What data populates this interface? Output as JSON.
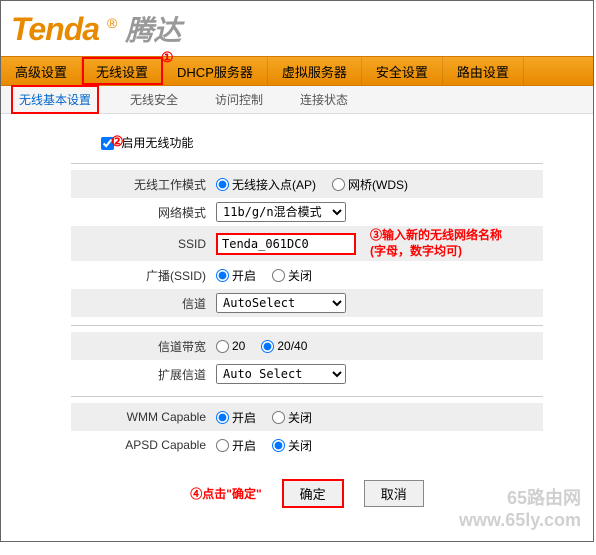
{
  "logo": {
    "text": "Tenda",
    "reg": "®",
    "cn": "腾达"
  },
  "mainNav": {
    "items": [
      "高级设置",
      "无线设置",
      "DHCP服务器",
      "虚拟服务器",
      "安全设置",
      "路由设置"
    ]
  },
  "subNav": {
    "items": [
      "无线基本设置",
      "无线安全",
      "访问控制",
      "连接状态"
    ]
  },
  "annotations": {
    "a1": "①",
    "a2": "②",
    "a3line1": "③输入新的无线网络名称",
    "a3line2": "(字母，数字均可)",
    "a4": "④点击\"确定\""
  },
  "form": {
    "enableLabel": "启用无线功能",
    "workModeLabel": "无线工作模式",
    "workModeOptA": "无线接入点(AP)",
    "workModeOptB": "网桥(WDS)",
    "netModeLabel": "网络模式",
    "netModeValue": "11b/g/n混合模式",
    "ssidLabel": "SSID",
    "ssidValue": "Tenda_061DC0",
    "broadcastLabel": "广播(SSID)",
    "onLabel": "开启",
    "offLabel": "关闭",
    "channelLabel": "信道",
    "channelValue": "AutoSelect",
    "bwLabel": "信道带宽",
    "bwOptA": "20",
    "bwOptB": "20/40",
    "extChLabel": "扩展信道",
    "extChValue": "Auto Select",
    "wmmLabel": "WMM Capable",
    "apsdLabel": "APSD Capable"
  },
  "buttons": {
    "ok": "确定",
    "cancel": "取消"
  },
  "watermark": {
    "line1": "65路由网",
    "line2": "www.65ly.com"
  }
}
